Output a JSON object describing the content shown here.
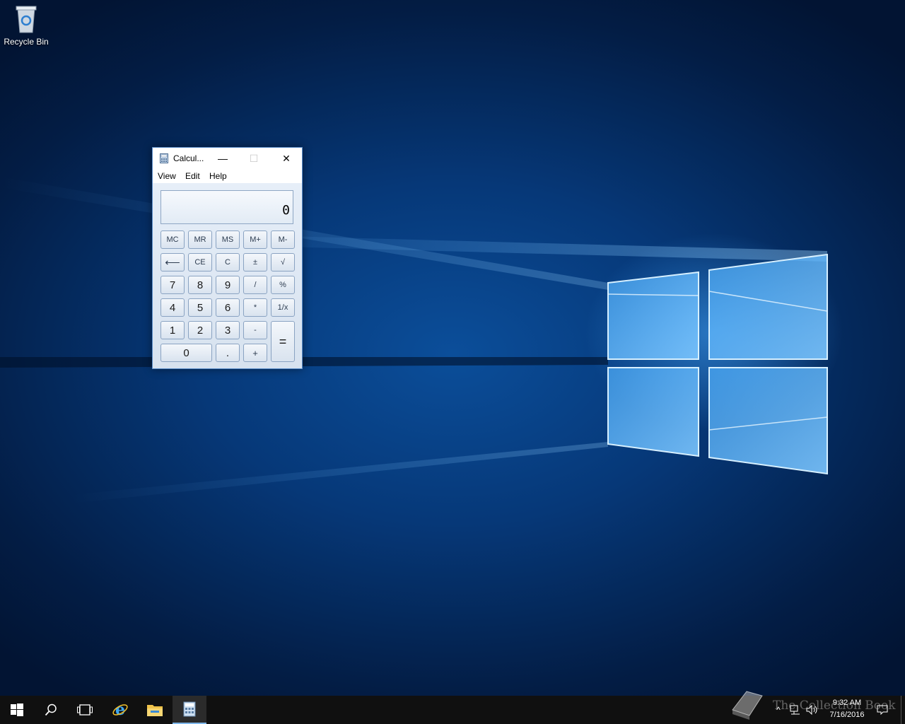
{
  "desktop": {
    "icons": [
      {
        "label": "Recycle Bin"
      }
    ]
  },
  "calculator": {
    "title": "Calcul...",
    "menu": [
      "View",
      "Edit",
      "Help"
    ],
    "display": "0",
    "keys": {
      "mc": "MC",
      "mr": "MR",
      "ms": "MS",
      "mplus": "M+",
      "mminus": "M-",
      "back": "⟵",
      "ce": "CE",
      "c": "C",
      "plusminus": "±",
      "sqrt": "√",
      "n7": "7",
      "n8": "8",
      "n9": "9",
      "div": "/",
      "pct": "%",
      "n4": "4",
      "n5": "5",
      "n6": "6",
      "mul": "*",
      "recip": "1/x",
      "n1": "1",
      "n2": "2",
      "n3": "3",
      "sub": "-",
      "eq": "=",
      "n0": "0",
      "dot": ".",
      "add": "+"
    },
    "window_controls": {
      "minimize": "—",
      "maximize": "☐",
      "close": "✕"
    }
  },
  "taskbar": {
    "items": [
      "start-icon",
      "search-icon",
      "task-view-icon",
      "internet-explorer-icon",
      "file-explorer-icon",
      "calculator-icon"
    ],
    "clock": {
      "time": "9:32 AM",
      "date": "7/16/2016"
    },
    "watermark": "The Collection Book"
  }
}
